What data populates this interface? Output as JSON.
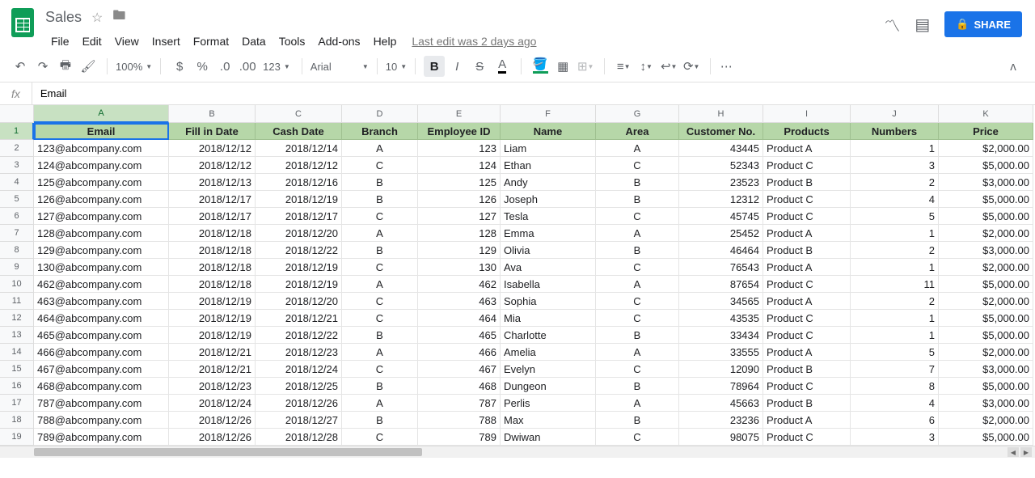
{
  "doc": {
    "title": "Sales"
  },
  "menus": [
    "File",
    "Edit",
    "View",
    "Insert",
    "Format",
    "Data",
    "Tools",
    "Add-ons",
    "Help"
  ],
  "last_edit": "Last edit was 2 days ago",
  "share_label": "SHARE",
  "toolbar": {
    "zoom": "100%",
    "font": "Arial",
    "size": "10",
    "numfmt": "123"
  },
  "formula": {
    "value": "Email"
  },
  "columns": [
    "A",
    "B",
    "C",
    "D",
    "E",
    "F",
    "G",
    "H",
    "I",
    "J",
    "K"
  ],
  "headers": [
    "Email",
    "Fill in Date",
    "Cash Date",
    "Branch",
    "Employee ID",
    "Name",
    "Area",
    "Customer No.",
    "Products",
    "Numbers",
    "Price"
  ],
  "rows": [
    [
      "123@abcompany.com",
      "2018/12/12",
      "2018/12/14",
      "A",
      "123",
      "Liam",
      "A",
      "43445",
      "Product A",
      "1",
      "$2,000.00"
    ],
    [
      "124@abcompany.com",
      "2018/12/12",
      "2018/12/12",
      "C",
      "124",
      "Ethan",
      "C",
      "52343",
      "Product C",
      "3",
      "$5,000.00"
    ],
    [
      "125@abcompany.com",
      "2018/12/13",
      "2018/12/16",
      "B",
      "125",
      "Andy",
      "B",
      "23523",
      "Product B",
      "2",
      "$3,000.00"
    ],
    [
      "126@abcompany.com",
      "2018/12/17",
      "2018/12/19",
      "B",
      "126",
      "Joseph",
      "B",
      "12312",
      "Product C",
      "4",
      "$5,000.00"
    ],
    [
      "127@abcompany.com",
      "2018/12/17",
      "2018/12/17",
      "C",
      "127",
      "Tesla",
      "C",
      "45745",
      "Product C",
      "5",
      "$5,000.00"
    ],
    [
      "128@abcompany.com",
      "2018/12/18",
      "2018/12/20",
      "A",
      "128",
      "Emma",
      "A",
      "25452",
      "Product A",
      "1",
      "$2,000.00"
    ],
    [
      "129@abcompany.com",
      "2018/12/18",
      "2018/12/22",
      "B",
      "129",
      "Olivia",
      "B",
      "46464",
      "Product B",
      "2",
      "$3,000.00"
    ],
    [
      "130@abcompany.com",
      "2018/12/18",
      "2018/12/19",
      "C",
      "130",
      "Ava",
      "C",
      "76543",
      "Product A",
      "1",
      "$2,000.00"
    ],
    [
      "462@abcompany.com",
      "2018/12/18",
      "2018/12/19",
      "A",
      "462",
      "Isabella",
      "A",
      "87654",
      "Product C",
      "11",
      "$5,000.00"
    ],
    [
      "463@abcompany.com",
      "2018/12/19",
      "2018/12/20",
      "C",
      "463",
      "Sophia",
      "C",
      "34565",
      "Product A",
      "2",
      "$2,000.00"
    ],
    [
      "464@abcompany.com",
      "2018/12/19",
      "2018/12/21",
      "C",
      "464",
      "Mia",
      "C",
      "43535",
      "Product C",
      "1",
      "$5,000.00"
    ],
    [
      "465@abcompany.com",
      "2018/12/19",
      "2018/12/22",
      "B",
      "465",
      "Charlotte",
      "B",
      "33434",
      "Product C",
      "1",
      "$5,000.00"
    ],
    [
      "466@abcompany.com",
      "2018/12/21",
      "2018/12/23",
      "A",
      "466",
      "Amelia",
      "A",
      "33555",
      "Product A",
      "5",
      "$2,000.00"
    ],
    [
      "467@abcompany.com",
      "2018/12/21",
      "2018/12/24",
      "C",
      "467",
      "Evelyn",
      "C",
      "12090",
      "Product B",
      "7",
      "$3,000.00"
    ],
    [
      "468@abcompany.com",
      "2018/12/23",
      "2018/12/25",
      "B",
      "468",
      "Dungeon",
      "B",
      "78964",
      "Product C",
      "8",
      "$5,000.00"
    ],
    [
      "787@abcompany.com",
      "2018/12/24",
      "2018/12/26",
      "A",
      "787",
      "Perlis",
      "A",
      "45663",
      "Product B",
      "4",
      "$3,000.00"
    ],
    [
      "788@abcompany.com",
      "2018/12/26",
      "2018/12/27",
      "B",
      "788",
      "Max",
      "B",
      "23236",
      "Product A",
      "6",
      "$2,000.00"
    ],
    [
      "789@abcompany.com",
      "2018/12/26",
      "2018/12/28",
      "C",
      "789",
      "Dwiwan",
      "C",
      "98075",
      "Product C",
      "3",
      "$5,000.00"
    ]
  ],
  "align": [
    "l",
    "r",
    "r",
    "c",
    "r",
    "l",
    "c",
    "r",
    "l",
    "r",
    "r"
  ],
  "chart_data": {
    "type": "table",
    "title": "Sales",
    "columns": [
      "Email",
      "Fill in Date",
      "Cash Date",
      "Branch",
      "Employee ID",
      "Name",
      "Area",
      "Customer No.",
      "Products",
      "Numbers",
      "Price"
    ],
    "data": [
      {
        "Email": "123@abcompany.com",
        "Fill in Date": "2018/12/12",
        "Cash Date": "2018/12/14",
        "Branch": "A",
        "Employee ID": 123,
        "Name": "Liam",
        "Area": "A",
        "Customer No.": 43445,
        "Products": "Product A",
        "Numbers": 1,
        "Price": 2000.0
      },
      {
        "Email": "124@abcompany.com",
        "Fill in Date": "2018/12/12",
        "Cash Date": "2018/12/12",
        "Branch": "C",
        "Employee ID": 124,
        "Name": "Ethan",
        "Area": "C",
        "Customer No.": 52343,
        "Products": "Product C",
        "Numbers": 3,
        "Price": 5000.0
      },
      {
        "Email": "125@abcompany.com",
        "Fill in Date": "2018/12/13",
        "Cash Date": "2018/12/16",
        "Branch": "B",
        "Employee ID": 125,
        "Name": "Andy",
        "Area": "B",
        "Customer No.": 23523,
        "Products": "Product B",
        "Numbers": 2,
        "Price": 3000.0
      },
      {
        "Email": "126@abcompany.com",
        "Fill in Date": "2018/12/17",
        "Cash Date": "2018/12/19",
        "Branch": "B",
        "Employee ID": 126,
        "Name": "Joseph",
        "Area": "B",
        "Customer No.": 12312,
        "Products": "Product C",
        "Numbers": 4,
        "Price": 5000.0
      },
      {
        "Email": "127@abcompany.com",
        "Fill in Date": "2018/12/17",
        "Cash Date": "2018/12/17",
        "Branch": "C",
        "Employee ID": 127,
        "Name": "Tesla",
        "Area": "C",
        "Customer No.": 45745,
        "Products": "Product C",
        "Numbers": 5,
        "Price": 5000.0
      },
      {
        "Email": "128@abcompany.com",
        "Fill in Date": "2018/12/18",
        "Cash Date": "2018/12/20",
        "Branch": "A",
        "Employee ID": 128,
        "Name": "Emma",
        "Area": "A",
        "Customer No.": 25452,
        "Products": "Product A",
        "Numbers": 1,
        "Price": 2000.0
      },
      {
        "Email": "129@abcompany.com",
        "Fill in Date": "2018/12/18",
        "Cash Date": "2018/12/22",
        "Branch": "B",
        "Employee ID": 129,
        "Name": "Olivia",
        "Area": "B",
        "Customer No.": 46464,
        "Products": "Product B",
        "Numbers": 2,
        "Price": 3000.0
      },
      {
        "Email": "130@abcompany.com",
        "Fill in Date": "2018/12/18",
        "Cash Date": "2018/12/19",
        "Branch": "C",
        "Employee ID": 130,
        "Name": "Ava",
        "Area": "C",
        "Customer No.": 76543,
        "Products": "Product A",
        "Numbers": 1,
        "Price": 2000.0
      },
      {
        "Email": "462@abcompany.com",
        "Fill in Date": "2018/12/18",
        "Cash Date": "2018/12/19",
        "Branch": "A",
        "Employee ID": 462,
        "Name": "Isabella",
        "Area": "A",
        "Customer No.": 87654,
        "Products": "Product C",
        "Numbers": 11,
        "Price": 5000.0
      },
      {
        "Email": "463@abcompany.com",
        "Fill in Date": "2018/12/19",
        "Cash Date": "2018/12/20",
        "Branch": "C",
        "Employee ID": 463,
        "Name": "Sophia",
        "Area": "C",
        "Customer No.": 34565,
        "Products": "Product A",
        "Numbers": 2,
        "Price": 2000.0
      },
      {
        "Email": "464@abcompany.com",
        "Fill in Date": "2018/12/19",
        "Cash Date": "2018/12/21",
        "Branch": "C",
        "Employee ID": 464,
        "Name": "Mia",
        "Area": "C",
        "Customer No.": 43535,
        "Products": "Product C",
        "Numbers": 1,
        "Price": 5000.0
      },
      {
        "Email": "465@abcompany.com",
        "Fill in Date": "2018/12/19",
        "Cash Date": "2018/12/22",
        "Branch": "B",
        "Employee ID": 465,
        "Name": "Charlotte",
        "Area": "B",
        "Customer No.": 33434,
        "Products": "Product C",
        "Numbers": 1,
        "Price": 5000.0
      },
      {
        "Email": "466@abcompany.com",
        "Fill in Date": "2018/12/21",
        "Cash Date": "2018/12/23",
        "Branch": "A",
        "Employee ID": 466,
        "Name": "Amelia",
        "Area": "A",
        "Customer No.": 33555,
        "Products": "Product A",
        "Numbers": 5,
        "Price": 2000.0
      },
      {
        "Email": "467@abcompany.com",
        "Fill in Date": "2018/12/21",
        "Cash Date": "2018/12/24",
        "Branch": "C",
        "Employee ID": 467,
        "Name": "Evelyn",
        "Area": "C",
        "Customer No.": 12090,
        "Products": "Product B",
        "Numbers": 7,
        "Price": 3000.0
      },
      {
        "Email": "468@abcompany.com",
        "Fill in Date": "2018/12/23",
        "Cash Date": "2018/12/25",
        "Branch": "B",
        "Employee ID": 468,
        "Name": "Dungeon",
        "Area": "B",
        "Customer No.": 78964,
        "Products": "Product C",
        "Numbers": 8,
        "Price": 5000.0
      },
      {
        "Email": "787@abcompany.com",
        "Fill in Date": "2018/12/24",
        "Cash Date": "2018/12/26",
        "Branch": "A",
        "Employee ID": 787,
        "Name": "Perlis",
        "Area": "A",
        "Customer No.": 45663,
        "Products": "Product B",
        "Numbers": 4,
        "Price": 3000.0
      },
      {
        "Email": "788@abcompany.com",
        "Fill in Date": "2018/12/26",
        "Cash Date": "2018/12/27",
        "Branch": "B",
        "Employee ID": 788,
        "Name": "Max",
        "Area": "B",
        "Customer No.": 23236,
        "Products": "Product A",
        "Numbers": 6,
        "Price": 2000.0
      },
      {
        "Email": "789@abcompany.com",
        "Fill in Date": "2018/12/26",
        "Cash Date": "2018/12/28",
        "Branch": "C",
        "Employee ID": 789,
        "Name": "Dwiwan",
        "Area": "C",
        "Customer No.": 98075,
        "Products": "Product C",
        "Numbers": 3,
        "Price": 5000.0
      }
    ]
  }
}
